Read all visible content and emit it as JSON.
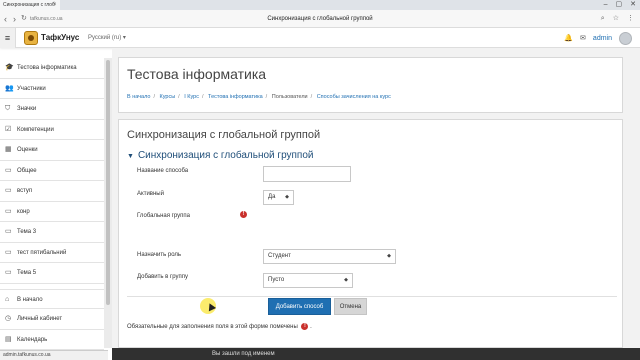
{
  "browser": {
    "tab_title": "Синхронизация с глоб",
    "url": "tafkunus.co.ua",
    "page_title": "Синхронизация с глобальной группой",
    "status_url": "admin.tafkunus.co.ua"
  },
  "navbar": {
    "site_name": "ТафкУнус",
    "language": "Русский (ru) ▾",
    "user_name": "admin"
  },
  "sidebar": {
    "items": [
      {
        "label": "Тестова інформатика",
        "icon": "graduation-cap-icon",
        "glyph": "🎓"
      },
      {
        "label": "Участники",
        "icon": "users-icon",
        "glyph": "👥"
      },
      {
        "label": "Значки",
        "icon": "shield-icon",
        "glyph": "⛉"
      },
      {
        "label": "Компетенции",
        "icon": "checkbox-icon",
        "glyph": "☑"
      },
      {
        "label": "Оценки",
        "icon": "grades-icon",
        "glyph": "▦"
      },
      {
        "label": "Общее",
        "icon": "folder-icon",
        "glyph": "▭"
      },
      {
        "label": "вступ",
        "icon": "folder-icon",
        "glyph": "▭"
      },
      {
        "label": "конр",
        "icon": "folder-icon",
        "glyph": "▭"
      },
      {
        "label": "Тема 3",
        "icon": "folder-icon",
        "glyph": "▭"
      },
      {
        "label": "тест пятибальний",
        "icon": "folder-icon",
        "glyph": "▭"
      },
      {
        "label": "Тема 5",
        "icon": "folder-icon",
        "glyph": "▭"
      },
      {
        "label": "В начало",
        "icon": "home-icon",
        "glyph": "⌂"
      },
      {
        "label": "Личный кабинет",
        "icon": "dashboard-icon",
        "glyph": "◷"
      },
      {
        "label": "Календарь",
        "icon": "calendar-icon",
        "glyph": "▤"
      }
    ]
  },
  "course": {
    "title": "Тестова інформатика"
  },
  "breadcrumb": {
    "items": [
      {
        "label": "В начало",
        "link": true
      },
      {
        "label": "Курсы",
        "link": true
      },
      {
        "label": "І Курс",
        "link": true
      },
      {
        "label": "Тестова інформатика",
        "link": true
      },
      {
        "label": "Пользователи",
        "link": false
      },
      {
        "label": "Способы зачисления на курс",
        "link": true
      }
    ]
  },
  "form": {
    "title": "Синхронизация с глобальной группой",
    "section": "Синхронизация с глобальной группой",
    "method_name_label": "Название способа",
    "method_name_value": "",
    "active_label": "Активный",
    "active_value": "Да",
    "cohort_label": "Глобальная группа",
    "role_label": "Назначить роль",
    "role_value": "Студент",
    "group_label": "Добавить в группу",
    "group_value": "Пусто",
    "submit_label": "Добавить способ",
    "cancel_label": "Отмена",
    "required_note": "Обязательные для заполнения поля в этой форме помечены",
    "required_note_end": "."
  },
  "footer": {
    "text": "Вы зашли под именем"
  },
  "colors": {
    "accent": "#1f6fb2",
    "required": "#c9302c",
    "heading": "#1f4e79"
  }
}
